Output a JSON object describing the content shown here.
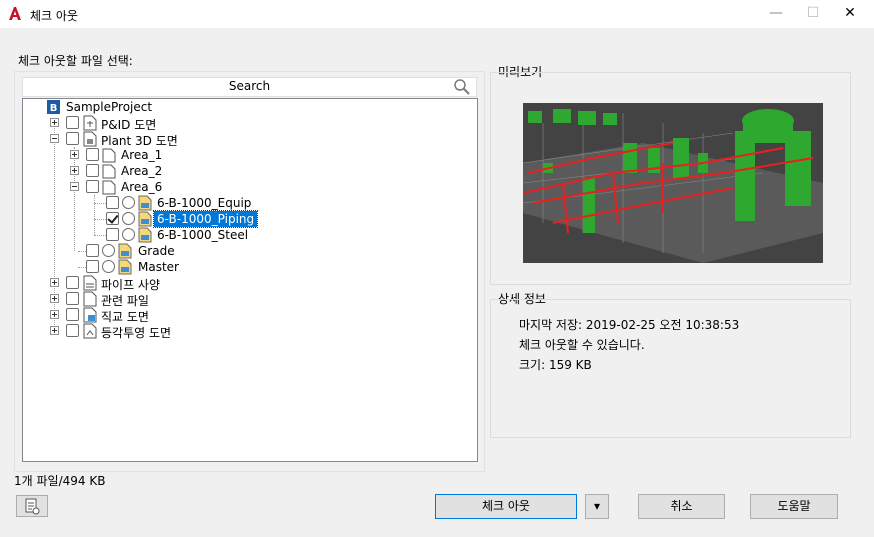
{
  "window": {
    "title": "체크 아웃",
    "minimize_glyph": "—",
    "maximize_glyph": "☐",
    "close_glyph": "✕"
  },
  "select_section": {
    "label": "체크 아웃할 파일 선택:",
    "search_placeholder": "Search"
  },
  "tree": {
    "root": "SampleProject",
    "pid": "P&ID 도면",
    "plant3d": "Plant 3D 도면",
    "area1": "Area_1",
    "area2": "Area_2",
    "area6": "Area_6",
    "equip": "6-B-1000_Equip",
    "piping": "6-B-1000_Piping",
    "steel": "6-B-1000_Steel",
    "grade": "Grade",
    "master": "Master",
    "pipespec": "파이프 사양",
    "related": "관련 파일",
    "ortho": "직교 도면",
    "iso": "등각투영 도면"
  },
  "preview": {
    "label": "미리보기"
  },
  "details": {
    "label": "상세 정보",
    "last_saved": "마지막 저장: 2019-02-25 오전 10:38:53",
    "status": "체크 아웃할 수 있습니다.",
    "size": "크기:  159 KB"
  },
  "footer": {
    "info": "1개 파일/494 KB",
    "checkout_button": "체크 아웃",
    "dropdown_glyph": "▾",
    "cancel_button": "취소",
    "help_button": "도움말"
  },
  "colors": {
    "accent": "#0078d7",
    "app_logo": "#c8102e",
    "preview_bg": "#434343"
  },
  "icons": [
    "autocad-logo-icon",
    "search-icon",
    "project-icon",
    "drawing-file-icon",
    "plant-folder-icon",
    "area-folder-icon",
    "dwg-file-icon",
    "list-icon"
  ]
}
